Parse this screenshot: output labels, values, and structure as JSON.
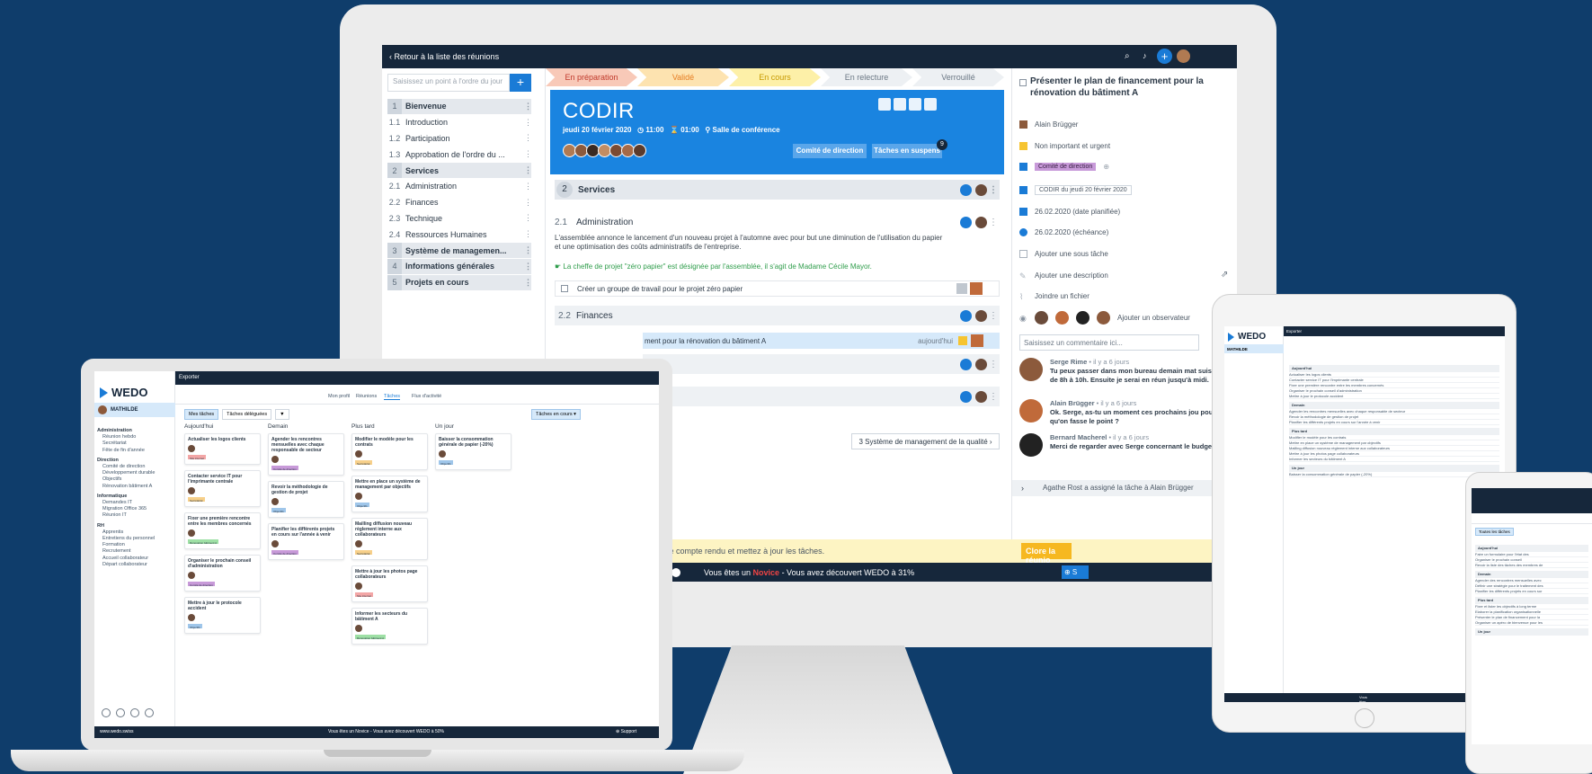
{
  "monitor": {
    "topbar": {
      "back": "‹ Retour à la liste des réunions"
    },
    "search_placeholder": "Saisissez un point à l'ordre du jour",
    "agenda": [
      {
        "num": "1",
        "label": "Bienvenue",
        "section": true
      },
      {
        "num": "1.1",
        "label": "Introduction",
        "section": false
      },
      {
        "num": "1.2",
        "label": "Participation",
        "section": false
      },
      {
        "num": "1.3",
        "label": "Approbation de l'ordre du ...",
        "section": false
      },
      {
        "num": "2",
        "label": "Services",
        "section": true
      },
      {
        "num": "2.1",
        "label": "Administration",
        "section": false
      },
      {
        "num": "2.2",
        "label": "Finances",
        "section": false
      },
      {
        "num": "2.3",
        "label": "Technique",
        "section": false
      },
      {
        "num": "2.4",
        "label": "Ressources Humaines",
        "section": false
      },
      {
        "num": "3",
        "label": "Système de managemen...",
        "section": true
      },
      {
        "num": "4",
        "label": "Informations générales",
        "section": true
      },
      {
        "num": "5",
        "label": "Projets en cours",
        "section": true
      }
    ],
    "steps": [
      {
        "label": "En préparation",
        "bg": "#f8c9b8",
        "fg": "#c0392b"
      },
      {
        "label": "Validé",
        "bg": "#fde3b0",
        "fg": "#e67e22"
      },
      {
        "label": "En cours",
        "bg": "#fdf0a8",
        "fg": "#c79a00"
      },
      {
        "label": "En relecture",
        "bg": "#edf0f3",
        "fg": "#6b7784"
      },
      {
        "label": "Verrouillé",
        "bg": "#edf0f3",
        "fg": "#6b7784"
      }
    ],
    "meeting": {
      "title": "CODIR",
      "date": "jeudi 20 février 2020",
      "time": "◷ 11:00",
      "duration": "⌛ 01:00",
      "room": "⚲ Salle de conférence",
      "tag1": "Comité de direction",
      "tag2": "Tâches en suspens",
      "badge": "9"
    },
    "sections": {
      "s2_num": "2",
      "s2_label": "Services",
      "s21_num": "2.1",
      "s21_label": "Administration",
      "para": "L'assemblée annonce le lancement d'un nouveau projet à l'automne avec pour but une diminution de l'utilisation du papier et une optimisation des coûts administratifs de l'entreprise.",
      "green": "☛ La cheffe de projet \"zéro papier\" est désignée par l'assemblée, il s'agit de Madame Cécile Mayor.",
      "task": "Créer un groupe de travail pour le projet zéro papier",
      "s22_num": "2.2",
      "s22_label": "Finances",
      "hl_text": "ment pour la rénovation du bâtiment A",
      "hl_date": "aujourd'hui",
      "es_text": "es",
      "next": "3 Système de management de la qualité ›"
    },
    "right": {
      "title": "Présenter le plan de financement pour la rénovation du bâtiment A",
      "owner": "Alain Brügger",
      "priority": "Non important et urgent",
      "chip": "Comité de direction",
      "meeting_ref": "CODIR du jeudi 20 février 2020",
      "date_planned": "26.02.2020 (date planifiée)",
      "date_due": "26.02.2020 (échéance)",
      "subtask": "Ajouter une sous tâche",
      "description": "Ajouter une description",
      "file": "Joindre un fichier",
      "observer": "Ajouter un observateur",
      "comment_placeholder": "Saisissez un commentaire ici...",
      "comments": [
        {
          "name": "Serge Rime",
          "when": " • il y a 6 jours",
          "text": "Tu peux passer dans mon bureau demain mat suis libre de 8h à 10h. Ensuite je serai en réun jusqu'à midi."
        },
        {
          "name": "Alain Brügger",
          "when": " • il y a 6 jours",
          "text": "Ok. Serge, as-tu un moment ces prochains jou pour qu'on fasse le point ?"
        },
        {
          "name": "Bernard Macherel",
          "when": " • il y a 6 jours",
          "text": "Merci de regarder avec Serge concernant le budget."
        }
      ],
      "assign": "Agathe Rost a assigné la tâche à Alain Brügger"
    },
    "yellow": {
      "text": "Rédigez votre compte rendu et mettez à jour les tâches.",
      "button": "Clore la réunio"
    },
    "novice": {
      "prefix": "Vous êtes un ",
      "level": "Novice",
      "suffix": " - Vous avez découvert WEDO à 31%",
      "support": "⊕ S"
    }
  },
  "laptop": {
    "logo": "WEDO",
    "user": "MATHILDE",
    "nav": [
      {
        "h": "Administration",
        "items": [
          "Réunion hebdo",
          "Secrétariat",
          "Fête de fin d'année"
        ]
      },
      {
        "h": "Direction",
        "items": [
          "Comité de direction",
          "Développement durable",
          "Objectifs",
          "Rénovation bâtiment A"
        ]
      },
      {
        "h": "Informatique",
        "items": [
          "Demandes IT",
          "Migration Office 365",
          "Réunion IT"
        ]
      },
      {
        "h": "RH",
        "items": [
          "Apprentis",
          "Entretiens du personnel",
          "Formation",
          "Recrutement",
          "Accueil collaborateur",
          "Départ collaborateur"
        ]
      }
    ],
    "topbar": "Exporter",
    "tabs": [
      "Mon profil",
      "Réunions",
      "Tâches",
      "Flux d'activité"
    ],
    "filters": [
      "Mes tâches",
      "Tâches déléguées"
    ],
    "filter_right": "Tâches en cours ▾",
    "columns": [
      {
        "title": "Aujourd'hui",
        "cards": [
          {
            "t": "Actualiser les logos clients",
            "c": "#f3a6a6",
            "l": "Site internet"
          },
          {
            "t": "Contacter service IT pour l'imprimante centrale",
            "c": "#f7d08a",
            "l": "Secrétariat"
          },
          {
            "t": "Fixer une première rencontre entre les membres concernés",
            "c": "#9ee0a5",
            "l": "Rénovation bâtiment A"
          },
          {
            "t": "Organiser le prochain conseil d'administration",
            "c": "#c89ad9",
            "l": "Comité de direction"
          },
          {
            "t": "Mettre à jour le protocole accident",
            "c": "#9fc6ea",
            "l": "Objectifs"
          }
        ]
      },
      {
        "title": "Demain",
        "cards": [
          {
            "t": "Agender les rencontres mensuelles avec chaque responsable de secteur",
            "c": "#c89ad9",
            "l": "Comité de direction"
          },
          {
            "t": "Revoir la méthodologie de gestion de projet",
            "c": "#9fc6ea",
            "l": "Objectifs"
          },
          {
            "t": "Planifier les différents projets en cours sur l'année à venir",
            "c": "#c89ad9",
            "l": "Comité de direction"
          }
        ]
      },
      {
        "title": "Plus tard",
        "cards": [
          {
            "t": "Modifier le modèle pour les contrats",
            "c": "#f7d08a",
            "l": "Secrétariat"
          },
          {
            "t": "Mettre en place un système de management par objectifs",
            "c": "#9fc6ea",
            "l": "Objectifs"
          },
          {
            "t": "Mailling diffusion nouveau règlement interne aux collaborateurs",
            "c": "#f7d08a",
            "l": "Secrétariat"
          },
          {
            "t": "Mettre à jour les photos page collaborateurs",
            "c": "#f3a6a6",
            "l": "Site internet"
          },
          {
            "t": "Informer les secteurs du bâtiment A",
            "c": "#9ee0a5",
            "l": "Rénovation bâtiment A"
          }
        ]
      },
      {
        "title": "Un jour",
        "cards": [
          {
            "t": "Baisser la consommation générale de papier (-20%)",
            "c": "#9fc6ea",
            "l": "Objectifs"
          }
        ]
      }
    ],
    "bottom": {
      "site": "www.wedo.swiss",
      "text": "Vous êtes un Novice - Vous avez découvert WEDO à 50%",
      "support": "⊕ Support"
    }
  },
  "tablet": {
    "logo": "WEDO",
    "user": "MATHILDE",
    "topbar": "Exporter",
    "groups": [
      "Aujourd'hui",
      "Demain",
      "Plus tard",
      "Un jour"
    ],
    "lines": [
      "Actualiser les logos clients",
      "Contacter service IT pour l'imprimante centrale",
      "Fixer une première rencontre entre les membres concernés",
      "Organiser le prochain conseil d'administration",
      "Mettre à jour le protocole accident",
      "Agender les rencontres mensuelles avec chaque responsable de secteur",
      "Revoir la méthodologie de gestion de projet",
      "Planifier les différents projets en cours sur l'année à venir",
      "Modifier le modèle pour les contrats",
      "Mettre en place un système de management par objectifs",
      "Mailling diffusion nouveau règlement interne aux collaborateurs",
      "Mettre à jour les photos page collaborateurs",
      "Informer les secteurs du bâtiment A",
      "Baisser la consommation générale de papier (-20%)"
    ],
    "bottom": "Vous êtes un Novice - Vous avez découvert WEDO à 50%"
  },
  "phone": {
    "filter": "Toutes les tâches",
    "groups": [
      "Aujourd'hui",
      "Demain",
      "Plus tard",
      "Un jour"
    ],
    "lines": [
      "Faire un formulaire pour l'état des",
      "Organiser le prochain conseil",
      "Revoir la liste des tâches des membres de",
      "Agender des rencontres mensuelles avec",
      "Définir une stratégie pour le traitement des",
      "Planifier les différents projets en cours sur",
      "Fixer et lister les objectifs à long terme",
      "Elaborer la planification organisationnelle",
      "Présenter le plan de financement pour la",
      "Organiser un apéro de bienvenue pour les"
    ]
  }
}
